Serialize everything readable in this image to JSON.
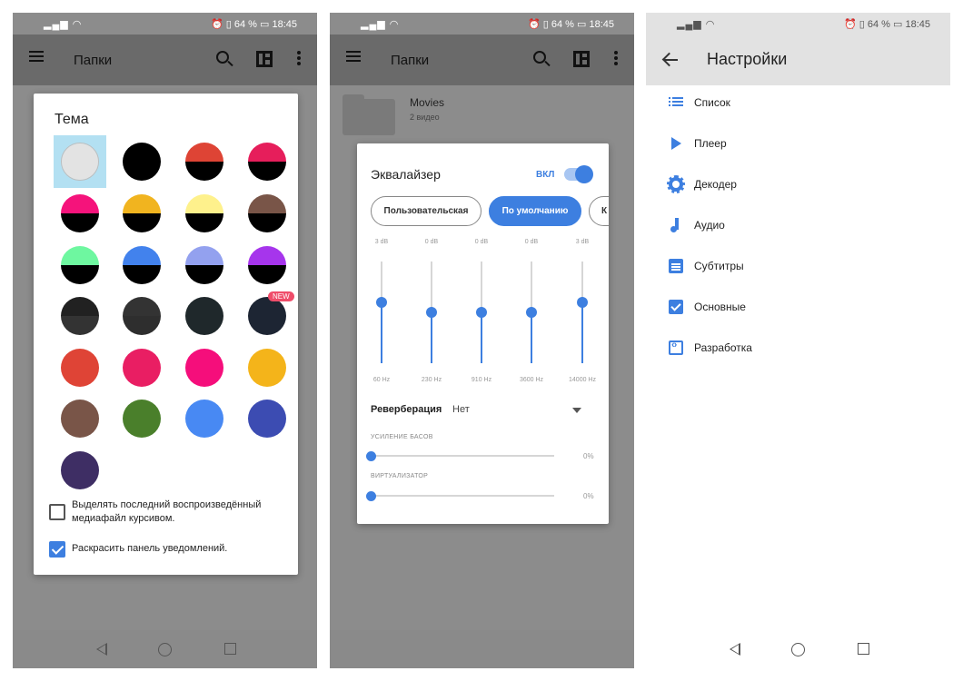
{
  "status": {
    "signal": "▂▄▆ ◠",
    "right_text": "⏰ ▯ 64 % ▭ 18:45",
    "right_text_p3": "⏰ ▯ 64 % ▭ 18:45"
  },
  "screen1": {
    "title": "Папки",
    "dialog_title": "Тема",
    "new_badge": "NEW",
    "swatches": [
      {
        "top": "#e3e3e3",
        "bottom": "#e3e3e3",
        "selected": true
      },
      {
        "top": "#000000",
        "bottom": "#000000"
      },
      {
        "top": "#de4435",
        "bottom": "#000000"
      },
      {
        "top": "#e61e5b",
        "bottom": "#000000"
      },
      {
        "top": "#f5137b",
        "bottom": "#000000"
      },
      {
        "top": "#f1b41f",
        "bottom": "#000000"
      },
      {
        "top": "#fef18c",
        "bottom": "#000000"
      },
      {
        "top": "#795548",
        "bottom": "#000000"
      },
      {
        "top": "#6ef7a0",
        "bottom": "#000000"
      },
      {
        "top": "#4282ed",
        "bottom": "#000000"
      },
      {
        "top": "#93a1ef",
        "bottom": "#000000"
      },
      {
        "top": "#a635ec",
        "bottom": "#000000"
      },
      {
        "top": "#212121",
        "bottom": "#333333"
      },
      {
        "top": "#333333",
        "bottom": "#2e2e2e"
      },
      {
        "top": "#1f282b",
        "bottom": "#1f282b"
      },
      {
        "top": "#1d2533",
        "bottom": "#1d2533",
        "badge": true
      },
      {
        "top": "#df4436",
        "bottom": "#df4436"
      },
      {
        "top": "#e91e63",
        "bottom": "#e91e63"
      },
      {
        "top": "#f50e7b",
        "bottom": "#f50e7b"
      },
      {
        "top": "#f4b41a",
        "bottom": "#f4b41a"
      },
      {
        "top": "#795548",
        "bottom": "#795548"
      },
      {
        "top": "#4a7f2b",
        "bottom": "#4a7f2b"
      },
      {
        "top": "#4889f3",
        "bottom": "#4889f3"
      },
      {
        "top": "#3c4cb2",
        "bottom": "#3c4cb2"
      },
      {
        "top": "#3e2e64",
        "bottom": "#3e2e64"
      }
    ],
    "option_italic": "Выделять последний воспроизведённый медиафайл курсивом.",
    "option_italic_checked": false,
    "option_color_notif": "Раскрасить панель уведомлений.",
    "option_color_notif_checked": true
  },
  "screen2": {
    "title": "Папки",
    "folder_name": "Movies",
    "folder_sub": "2 видео",
    "eq_title": "Эквалайзер",
    "eq_state": "ВКЛ",
    "presets": [
      "Пользовательская",
      "По умолчанию",
      "К"
    ],
    "active_preset": 1,
    "bands": [
      {
        "db": "3 dB",
        "hz": "60 Hz",
        "level": 0.6
      },
      {
        "db": "0 dB",
        "hz": "230 Hz",
        "level": 0.5
      },
      {
        "db": "0 dB",
        "hz": "910 Hz",
        "level": 0.5
      },
      {
        "db": "0 dB",
        "hz": "3600 Hz",
        "level": 0.5
      },
      {
        "db": "3 dB",
        "hz": "14000 Hz",
        "level": 0.6
      }
    ],
    "reverb_label": "Реверберация",
    "reverb_value": "Нет",
    "bass_label": "УСИЛЕНИЕ БАСОВ",
    "bass_value": "0%",
    "virt_label": "ВИРТУАЛИЗАТОР",
    "virt_value": "0%"
  },
  "screen3": {
    "title": "Настройки",
    "items": [
      {
        "label": "Список",
        "icon": "list-icon"
      },
      {
        "label": "Плеер",
        "icon": "play-icon"
      },
      {
        "label": "Декодер",
        "icon": "gear-icon"
      },
      {
        "label": "Аудио",
        "icon": "music-note-icon"
      },
      {
        "label": "Субтитры",
        "icon": "subtitles-icon"
      },
      {
        "label": "Основные",
        "icon": "checkbox-icon"
      },
      {
        "label": "Разработка",
        "icon": "developer-icon"
      }
    ]
  },
  "colors": {
    "accent": "#3d7fe0",
    "scrim": "#8c8c8c",
    "appbar_dim": "#6a6a6a"
  }
}
